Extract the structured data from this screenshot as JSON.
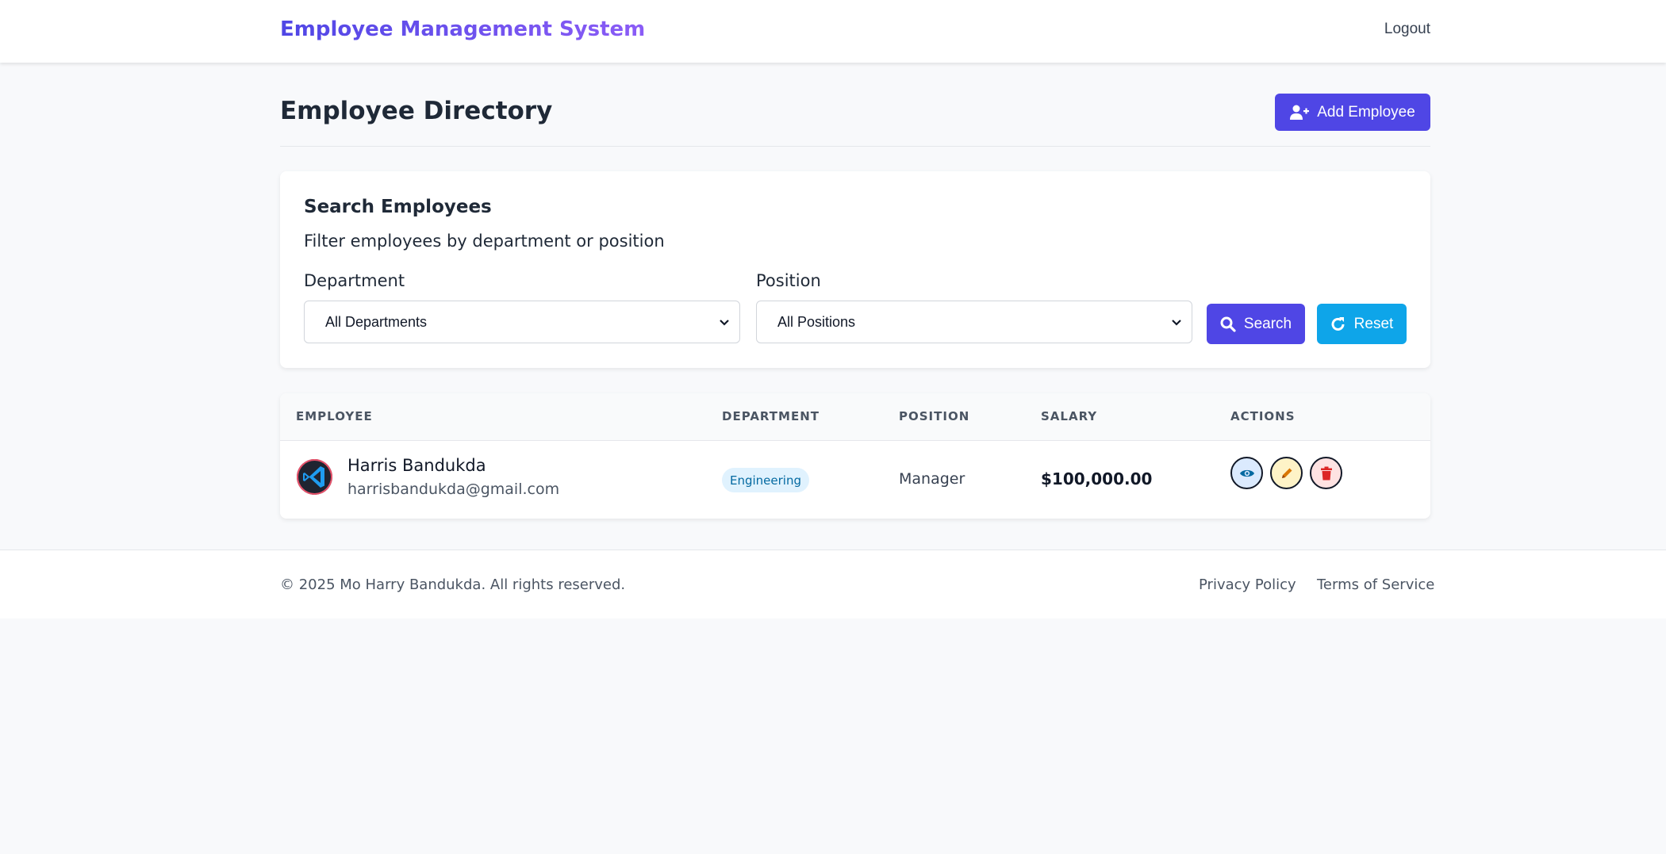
{
  "header": {
    "brand": "Employee Management System",
    "logout_label": "Logout"
  },
  "page": {
    "title": "Employee Directory",
    "add_button_label": "Add Employee"
  },
  "search": {
    "title": "Search Employees",
    "subtitle": "Filter employees by department or position",
    "department_label": "Department",
    "department_value": "All Departments",
    "position_label": "Position",
    "position_value": "All Positions",
    "search_button_label": "Search",
    "reset_button_label": "Reset"
  },
  "table": {
    "columns": [
      "EMPLOYEE",
      "DEPARTMENT",
      "POSITION",
      "SALARY",
      "ACTIONS"
    ],
    "rows": [
      {
        "name": "Harris Bandukda",
        "email": "harrisbandukda@gmail.com",
        "department": "Engineering",
        "position": "Manager",
        "salary": "$100,000.00",
        "actions": [
          "eye-icon",
          "pencil-icon",
          "trash-icon"
        ]
      }
    ]
  },
  "footer": {
    "copyright": "© 2025 Mo Harry Bandukda. All rights reserved.",
    "links": [
      "Privacy Policy",
      "Terms of Service"
    ]
  },
  "colors": {
    "primary": "#4f46e5",
    "info": "#0ea5e9",
    "background": "#f8f9fb"
  }
}
